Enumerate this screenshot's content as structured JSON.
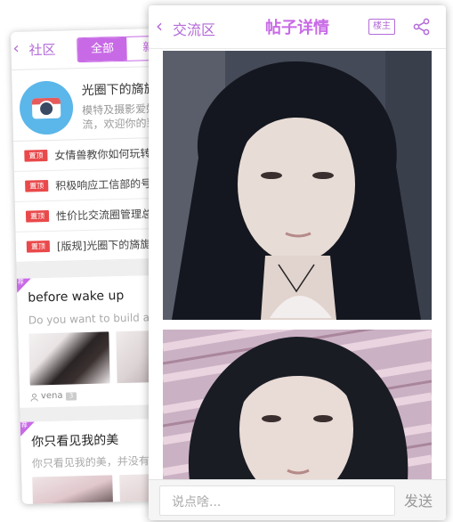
{
  "back_screen": {
    "nav": {
      "back_label": "社区",
      "tab_active": "全部",
      "tab_inactive": "新帖"
    },
    "group": {
      "title": "光圈下的旖旎",
      "description": "模特及摄影爱好者交流，欢迎你的到来。"
    },
    "pinned_badge": "置顶",
    "pinned_posts": [
      "女情兽教你如何玩转光圈",
      "积极响应工信部的号召",
      "性价比交流圈管理总则",
      "[版规]光圈下的旖旎"
    ],
    "ribbon_label": "荐",
    "posts": [
      {
        "title": "before wake up",
        "subtitle": "Do you want to build a snowman",
        "author": "vena",
        "count": "3"
      },
      {
        "title": "你只看见我的美",
        "subtitle": "你只看见我的美，并没有看见我的"
      }
    ]
  },
  "front_screen": {
    "nav": {
      "back_label": "交流区",
      "title": "帖子详情",
      "owner_button": "楼主"
    },
    "composer": {
      "placeholder": "说点啥...",
      "send_label": "发送"
    }
  },
  "colors": {
    "accent": "#c86ae6",
    "pin_red": "#e9494b"
  },
  "icons": {
    "back": "chevron-left-icon",
    "share": "share-icon",
    "camera": "camera-icon",
    "user": "user-icon"
  }
}
